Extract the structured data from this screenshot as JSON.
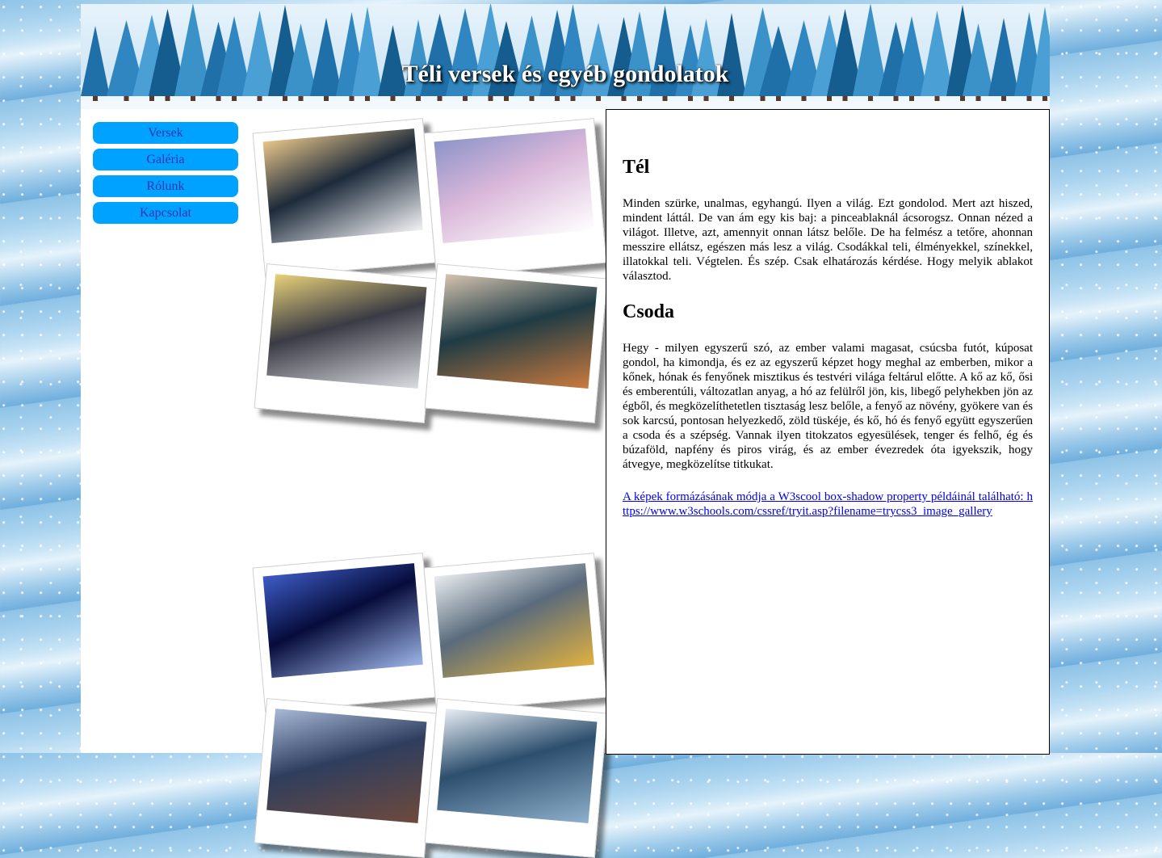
{
  "header": {
    "title": "Téli versek és egyéb gondolatok"
  },
  "nav": {
    "items": [
      {
        "label": "Versek"
      },
      {
        "label": "Galéria"
      },
      {
        "label": "Rólunk"
      },
      {
        "label": "Kapcsolat"
      }
    ]
  },
  "gallery": {
    "photos": [
      {
        "subject": "snowy road at sunset",
        "colors": [
          "#1c2a3a",
          "#e8c58a",
          "#f2f2f4"
        ]
      },
      {
        "subject": "pink winter castle by lake",
        "colors": [
          "#d9b7d9",
          "#8d94c9",
          "#ffffff"
        ]
      },
      {
        "subject": "lantern in snow",
        "colors": [
          "#3a3b44",
          "#e9d27a",
          "#dcdde3"
        ]
      },
      {
        "subject": "girl in snow with breath",
        "colors": [
          "#1f3b45",
          "#d6c4b0",
          "#c97a3d"
        ]
      },
      {
        "subject": "blue forest night",
        "colors": [
          "#060c3a",
          "#3e5cc7",
          "#9db4e8"
        ]
      },
      {
        "subject": "alpine village by lake",
        "colors": [
          "#5a6b7c",
          "#e9ecef",
          "#e0b040"
        ]
      },
      {
        "subject": "winter river",
        "colors": [
          "#2f3e5e",
          "#a8b9d8",
          "#6f4a3c"
        ]
      },
      {
        "subject": "frosted trees",
        "colors": [
          "#2d4f6e",
          "#e8eef4",
          "#8fb0cc"
        ]
      }
    ]
  },
  "content": {
    "section1": {
      "heading": "Tél",
      "text": "Minden szürke, unalmas, egyhangú. Ilyen a világ. Ezt gondolod. Mert azt hiszed, mindent láttál. De van ám egy kis baj: a pinceablaknál ácsorogsz. Onnan nézed a világot. Illetve, azt, amennyit onnan látsz belőle. De ha felmész a tetőre, ahonnan messzire ellátsz, egészen más lesz a világ. Csodákkal teli, élményekkel, színekkel, illatokkal teli. Végtelen. És szép. Csak elhatározás kérdése. Hogy melyik ablakot választod."
    },
    "section2": {
      "heading": "Csoda",
      "text": "Hegy - milyen egyszerű szó, az ember valami magasat, csúcsba futót, kúposat gondol, ha kimondja, és ez az egyszerű képzet hogy meghal az emberben, mikor a kőnek, hónak és fenyőnek misztikus és testvéri világa feltárul előtte. A kő az kő, ősi és emberentúli, változatlan anyag, a hó az felülről jön, kis, libegő pelyhekben jön az égből, és megközelíthetetlen tisztaság lesz belőle, a fenyő az növény, gyökere van és sok karcsú, pontosan helyezkedő, zöld tüskéje, és kő, hó és fenyő együtt egyszerűen a csoda és a szépség. Vannak ilyen titokzatos egyesülések, tenger és felhő, ég és búzaföld, napfény és piros virág, és az ember évezredek óta igyekszik, hogy átvegye, megközelítse titkukat."
    },
    "link_text": "A képek formázásának módja a W3scool box-shadow property példáinál található: https://www.w3schools.com/cssref/tryit.asp?filename=trycss3_image_gallery"
  }
}
